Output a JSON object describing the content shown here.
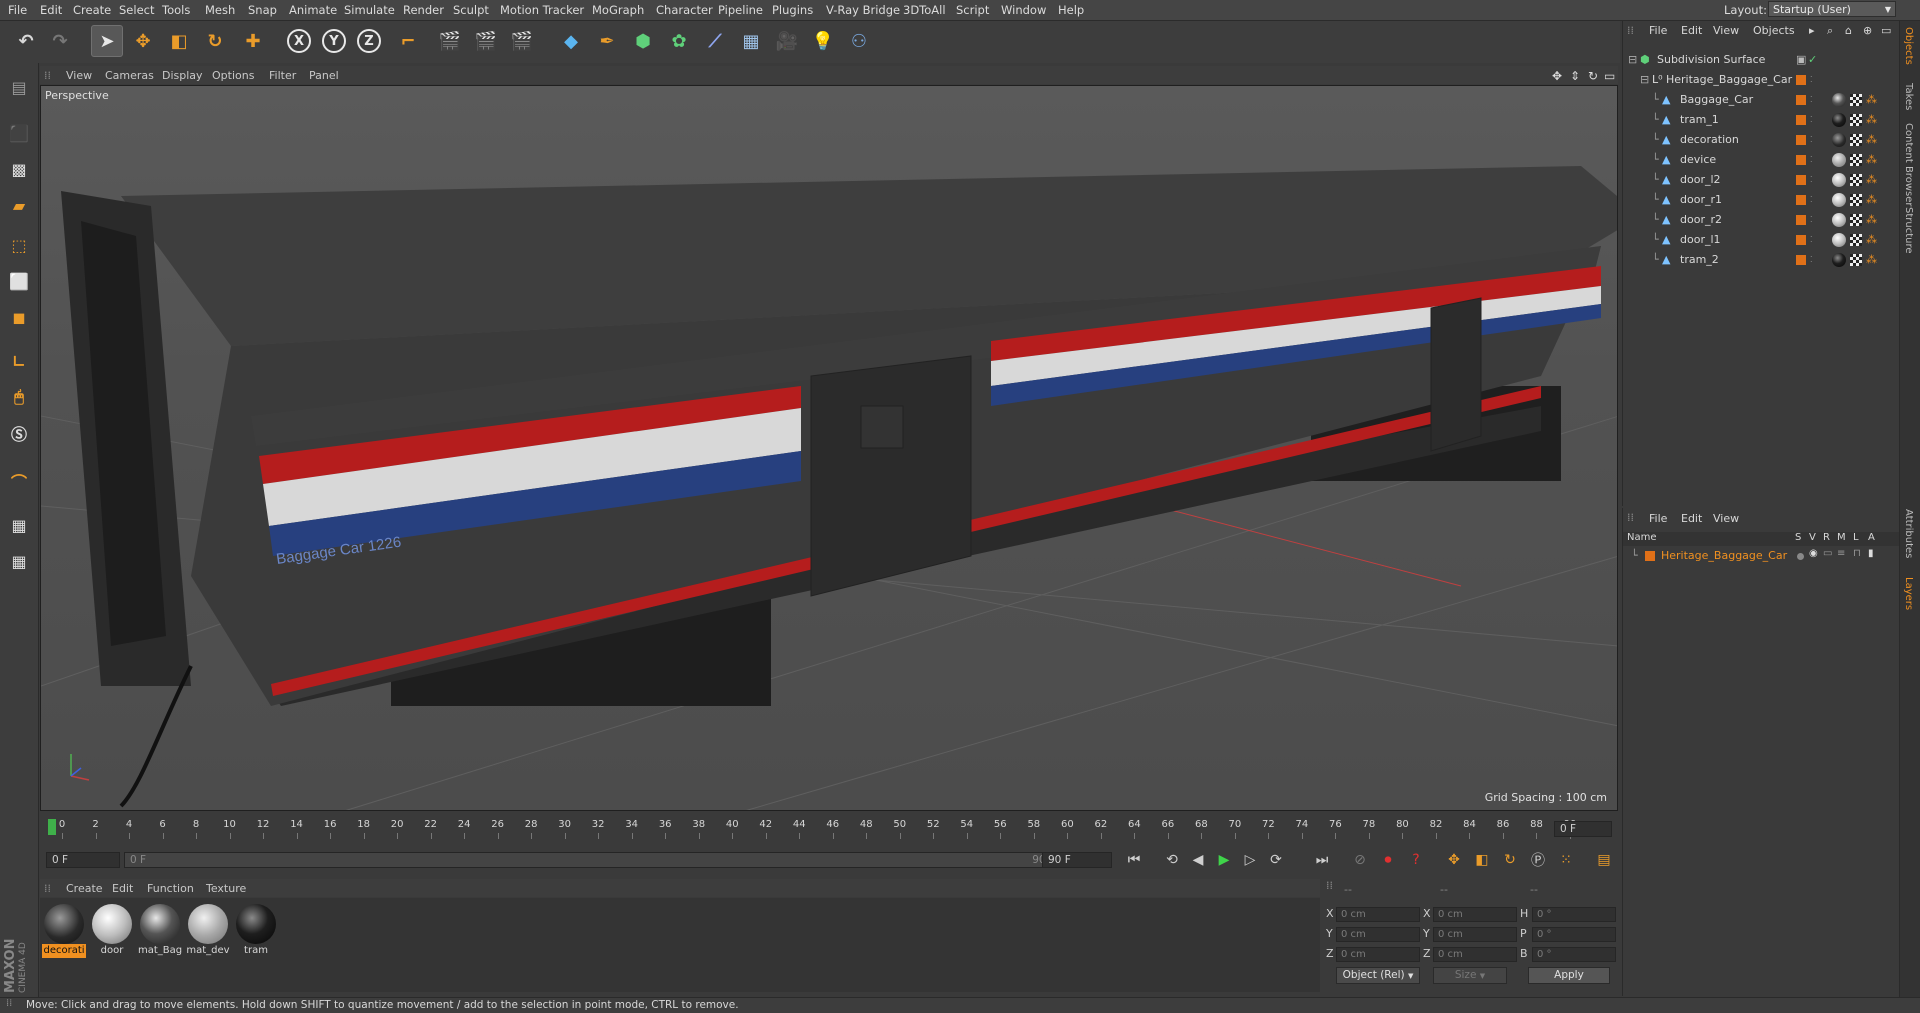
{
  "menu": [
    "File",
    "Edit",
    "Create",
    "Select",
    "Tools",
    "Mesh",
    "Snap",
    "Animate",
    "Simulate",
    "Render",
    "Sculpt",
    "Motion Tracker",
    "MoGraph",
    "Character",
    "Pipeline",
    "Plugins",
    "V-Ray Bridge",
    "3DToAll",
    "Script",
    "Window",
    "Help"
  ],
  "layout": {
    "label": "Layout:",
    "value": "Startup (User)"
  },
  "viewport": {
    "menu": [
      "View",
      "Cameras",
      "Display",
      "Options",
      "Filter",
      "Panel"
    ],
    "label": "Perspective",
    "grid_spacing": "Grid Spacing : 100 cm",
    "car_text": "Baggage Car 1226"
  },
  "timeline": {
    "ticks": [
      "0",
      "2",
      "4",
      "6",
      "8",
      "10",
      "12",
      "14",
      "16",
      "18",
      "20",
      "22",
      "24",
      "26",
      "28",
      "30",
      "32",
      "34",
      "36",
      "38",
      "40",
      "42",
      "44",
      "46",
      "48",
      "50",
      "52",
      "54",
      "56",
      "58",
      "60",
      "62",
      "64",
      "66",
      "68",
      "70",
      "72",
      "74",
      "76",
      "78",
      "80",
      "82",
      "84",
      "86",
      "88",
      "90"
    ],
    "current_frame": "0 F",
    "start_field": "0 F",
    "range_start": "0 F",
    "range_end": "90 F",
    "end_field": "90 F"
  },
  "materials": {
    "menu": [
      "Create",
      "Edit",
      "Function",
      "Texture"
    ],
    "items": [
      {
        "label": "decorati",
        "color": "radial-gradient(circle at 40% 35%, #9a9a9a, #2a2a2a 55%, #111)",
        "selected": true
      },
      {
        "label": "door",
        "color": "radial-gradient(circle at 40% 35%, #ffffff, #bdbdbd 50%, #6a6a6a)",
        "selected": false
      },
      {
        "label": "mat_Bag",
        "color": "radial-gradient(circle at 40% 35%, #e8e8e8, #555 45%, #1a1a1a)",
        "selected": false
      },
      {
        "label": "mat_dev",
        "color": "radial-gradient(circle at 40% 35%, #f0f0f0, #a8a8a8 50%, #707070)",
        "selected": false
      },
      {
        "label": "tram",
        "color": "radial-gradient(circle at 40% 35%, #8a8a8a, #1e1e1e 45%, #050505)",
        "selected": false
      }
    ]
  },
  "coords": {
    "labels": [
      "X",
      "Y",
      "Z",
      "X",
      "Y",
      "Z",
      "H",
      "P",
      "B"
    ],
    "pos": [
      "0 cm",
      "0 cm",
      "0 cm"
    ],
    "size": [
      "0 cm",
      "0 cm",
      "0 cm"
    ],
    "rot": [
      "0 °",
      "0 °",
      "0 °"
    ],
    "mode": "Object (Rel)",
    "size_mode": "Size",
    "apply": "Apply",
    "dashes": [
      "--",
      "--",
      "--"
    ]
  },
  "object_manager": {
    "menu": [
      "File",
      "Edit",
      "View",
      "Objects"
    ],
    "objects": [
      {
        "name": "Subdivision Surface",
        "indent": 0
      },
      {
        "name": "Heritage_Baggage_Car",
        "indent": 1
      },
      {
        "name": "Baggage_Car",
        "indent": 2
      },
      {
        "name": "tram_1",
        "indent": 2
      },
      {
        "name": "decoration",
        "indent": 2
      },
      {
        "name": "device",
        "indent": 2
      },
      {
        "name": "door_l2",
        "indent": 2
      },
      {
        "name": "door_r1",
        "indent": 2
      },
      {
        "name": "door_r2",
        "indent": 2
      },
      {
        "name": "door_l1",
        "indent": 2
      },
      {
        "name": "tram_2",
        "indent": 2
      }
    ]
  },
  "layer_manager": {
    "menu": [
      "File",
      "Edit",
      "View"
    ],
    "columns": [
      "Name",
      "S",
      "V",
      "R",
      "M",
      "L",
      "A"
    ],
    "layers": [
      {
        "name": "Heritage_Baggage_Car",
        "color": "#e07018"
      }
    ]
  },
  "right_tabs": [
    "Objects",
    "Takes",
    "Content Browser",
    "Structure",
    "Attributes",
    "Layers"
  ],
  "status": "Move: Click and drag to move elements. Hold down SHIFT to quantize movement / add to the selection in point mode, CTRL to remove.",
  "brand": {
    "line1": "MAXON",
    "line2": "CINEMA 4D"
  },
  "colors": {
    "accent": "#f09020",
    "stripe_red": "#b51d1d",
    "stripe_blue": "#27407f"
  }
}
